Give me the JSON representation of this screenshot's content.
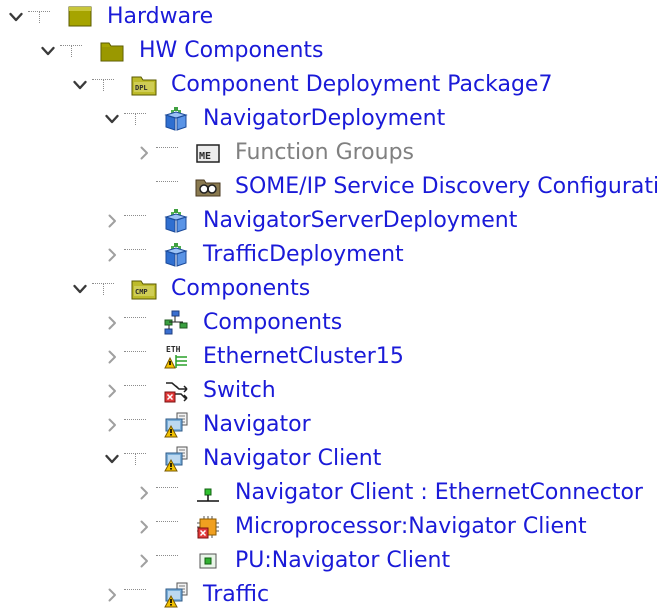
{
  "tree": {
    "nodes": [
      {
        "label": "Hardware",
        "depth": 0,
        "state": "expanded",
        "icon": "hardware-folder-icon"
      },
      {
        "label": "HW Components",
        "depth": 1,
        "state": "expanded",
        "icon": "folder-icon"
      },
      {
        "label": "Component Deployment Package7",
        "depth": 2,
        "state": "expanded",
        "icon": "dpl-package-icon",
        "icon_text": "DPL"
      },
      {
        "label": "NavigatorDeployment",
        "depth": 3,
        "state": "expanded",
        "icon": "deployment-icon"
      },
      {
        "label": "Function Groups",
        "depth": 4,
        "state": "collapsed",
        "icon": "function-groups-me-icon",
        "icon_text": "ME",
        "muted": true
      },
      {
        "label": "SOME/IP Service Discovery Configuration",
        "depth": 4,
        "state": "leaf",
        "icon": "service-discovery-config-icon"
      },
      {
        "label": "NavigatorServerDeployment",
        "depth": 3,
        "state": "collapsed",
        "icon": "deployment-icon"
      },
      {
        "label": "TrafficDeployment",
        "depth": 3,
        "state": "collapsed",
        "icon": "deployment-icon"
      },
      {
        "label": "Components",
        "depth": 2,
        "state": "expanded",
        "icon": "cmp-package-icon",
        "icon_text": "CMP"
      },
      {
        "label": "Components",
        "depth": 3,
        "state": "collapsed",
        "icon": "component-tree-icon"
      },
      {
        "label": "EthernetCluster15",
        "depth": 3,
        "state": "collapsed",
        "icon": "ethernet-cluster-icon",
        "icon_text": "ETH"
      },
      {
        "label": "Switch",
        "depth": 3,
        "state": "collapsed",
        "icon": "switch-icon"
      },
      {
        "label": "Navigator",
        "depth": 3,
        "state": "collapsed",
        "icon": "ecu-warning-icon"
      },
      {
        "label": "Navigator Client",
        "depth": 3,
        "state": "expanded",
        "icon": "ecu-warning-icon"
      },
      {
        "label": "Navigator Client : EthernetConnector",
        "depth": 4,
        "state": "collapsed",
        "icon": "ethernet-connector-icon"
      },
      {
        "label": "Microprocessor:Navigator Client",
        "depth": 4,
        "state": "collapsed",
        "icon": "microprocessor-icon"
      },
      {
        "label": "PU:Navigator Client",
        "depth": 4,
        "state": "collapsed",
        "icon": "processing-unit-icon"
      },
      {
        "label": "Traffic",
        "depth": 3,
        "state": "collapsed",
        "icon": "ecu-warning-icon"
      }
    ]
  },
  "colors": {
    "label": "#1a1ad8",
    "label_muted": "#808080",
    "folder": "#9a9a00",
    "arrow": "#3a3a3a",
    "arrow_muted": "#9a9a9a"
  }
}
